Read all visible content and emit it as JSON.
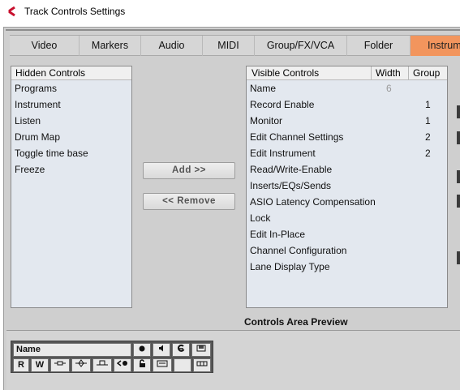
{
  "window": {
    "title": "Track Controls Settings"
  },
  "tabs": [
    {
      "label": "Video",
      "active": false
    },
    {
      "label": "Markers",
      "active": false
    },
    {
      "label": "Audio",
      "active": false
    },
    {
      "label": "MIDI",
      "active": false
    },
    {
      "label": "Group/FX/VCA",
      "active": false
    },
    {
      "label": "Folder",
      "active": false
    },
    {
      "label": "Instrum",
      "active": true
    }
  ],
  "hidden_controls": {
    "header": "Hidden Controls",
    "items": [
      "Programs",
      "Instrument",
      "Listen",
      "Drum Map",
      "Toggle time base",
      "Freeze"
    ]
  },
  "buttons": {
    "add": "Add >>",
    "remove": "<< Remove"
  },
  "visible_controls": {
    "header_name": "Visible Controls",
    "header_width": "Width",
    "header_group": "Group",
    "rows": [
      {
        "name": "Name",
        "width": "6",
        "group": ""
      },
      {
        "name": "Record Enable",
        "width": "",
        "group": "1"
      },
      {
        "name": "Monitor",
        "width": "",
        "group": "1"
      },
      {
        "name": "Edit Channel Settings",
        "width": "",
        "group": "2"
      },
      {
        "name": "Edit Instrument",
        "width": "",
        "group": "2"
      },
      {
        "name": "Read/Write-Enable",
        "width": "",
        "group": ""
      },
      {
        "name": "Inserts/EQs/Sends",
        "width": "",
        "group": ""
      },
      {
        "name": "ASIO Latency Compensation",
        "width": "",
        "group": ""
      },
      {
        "name": "Lock",
        "width": "",
        "group": ""
      },
      {
        "name": "Edit In-Place",
        "width": "",
        "group": ""
      },
      {
        "name": "Channel Configuration",
        "width": "",
        "group": ""
      },
      {
        "name": "Lane Display Type",
        "width": "",
        "group": ""
      }
    ]
  },
  "preview": {
    "label": "Controls Area Preview",
    "name_field": "Name",
    "read_button": "R",
    "write_button": "W"
  },
  "colors": {
    "active_tab": "#f2955d",
    "list_bg": "#e3e8ef",
    "dialog_bg": "#cfcfcf"
  }
}
